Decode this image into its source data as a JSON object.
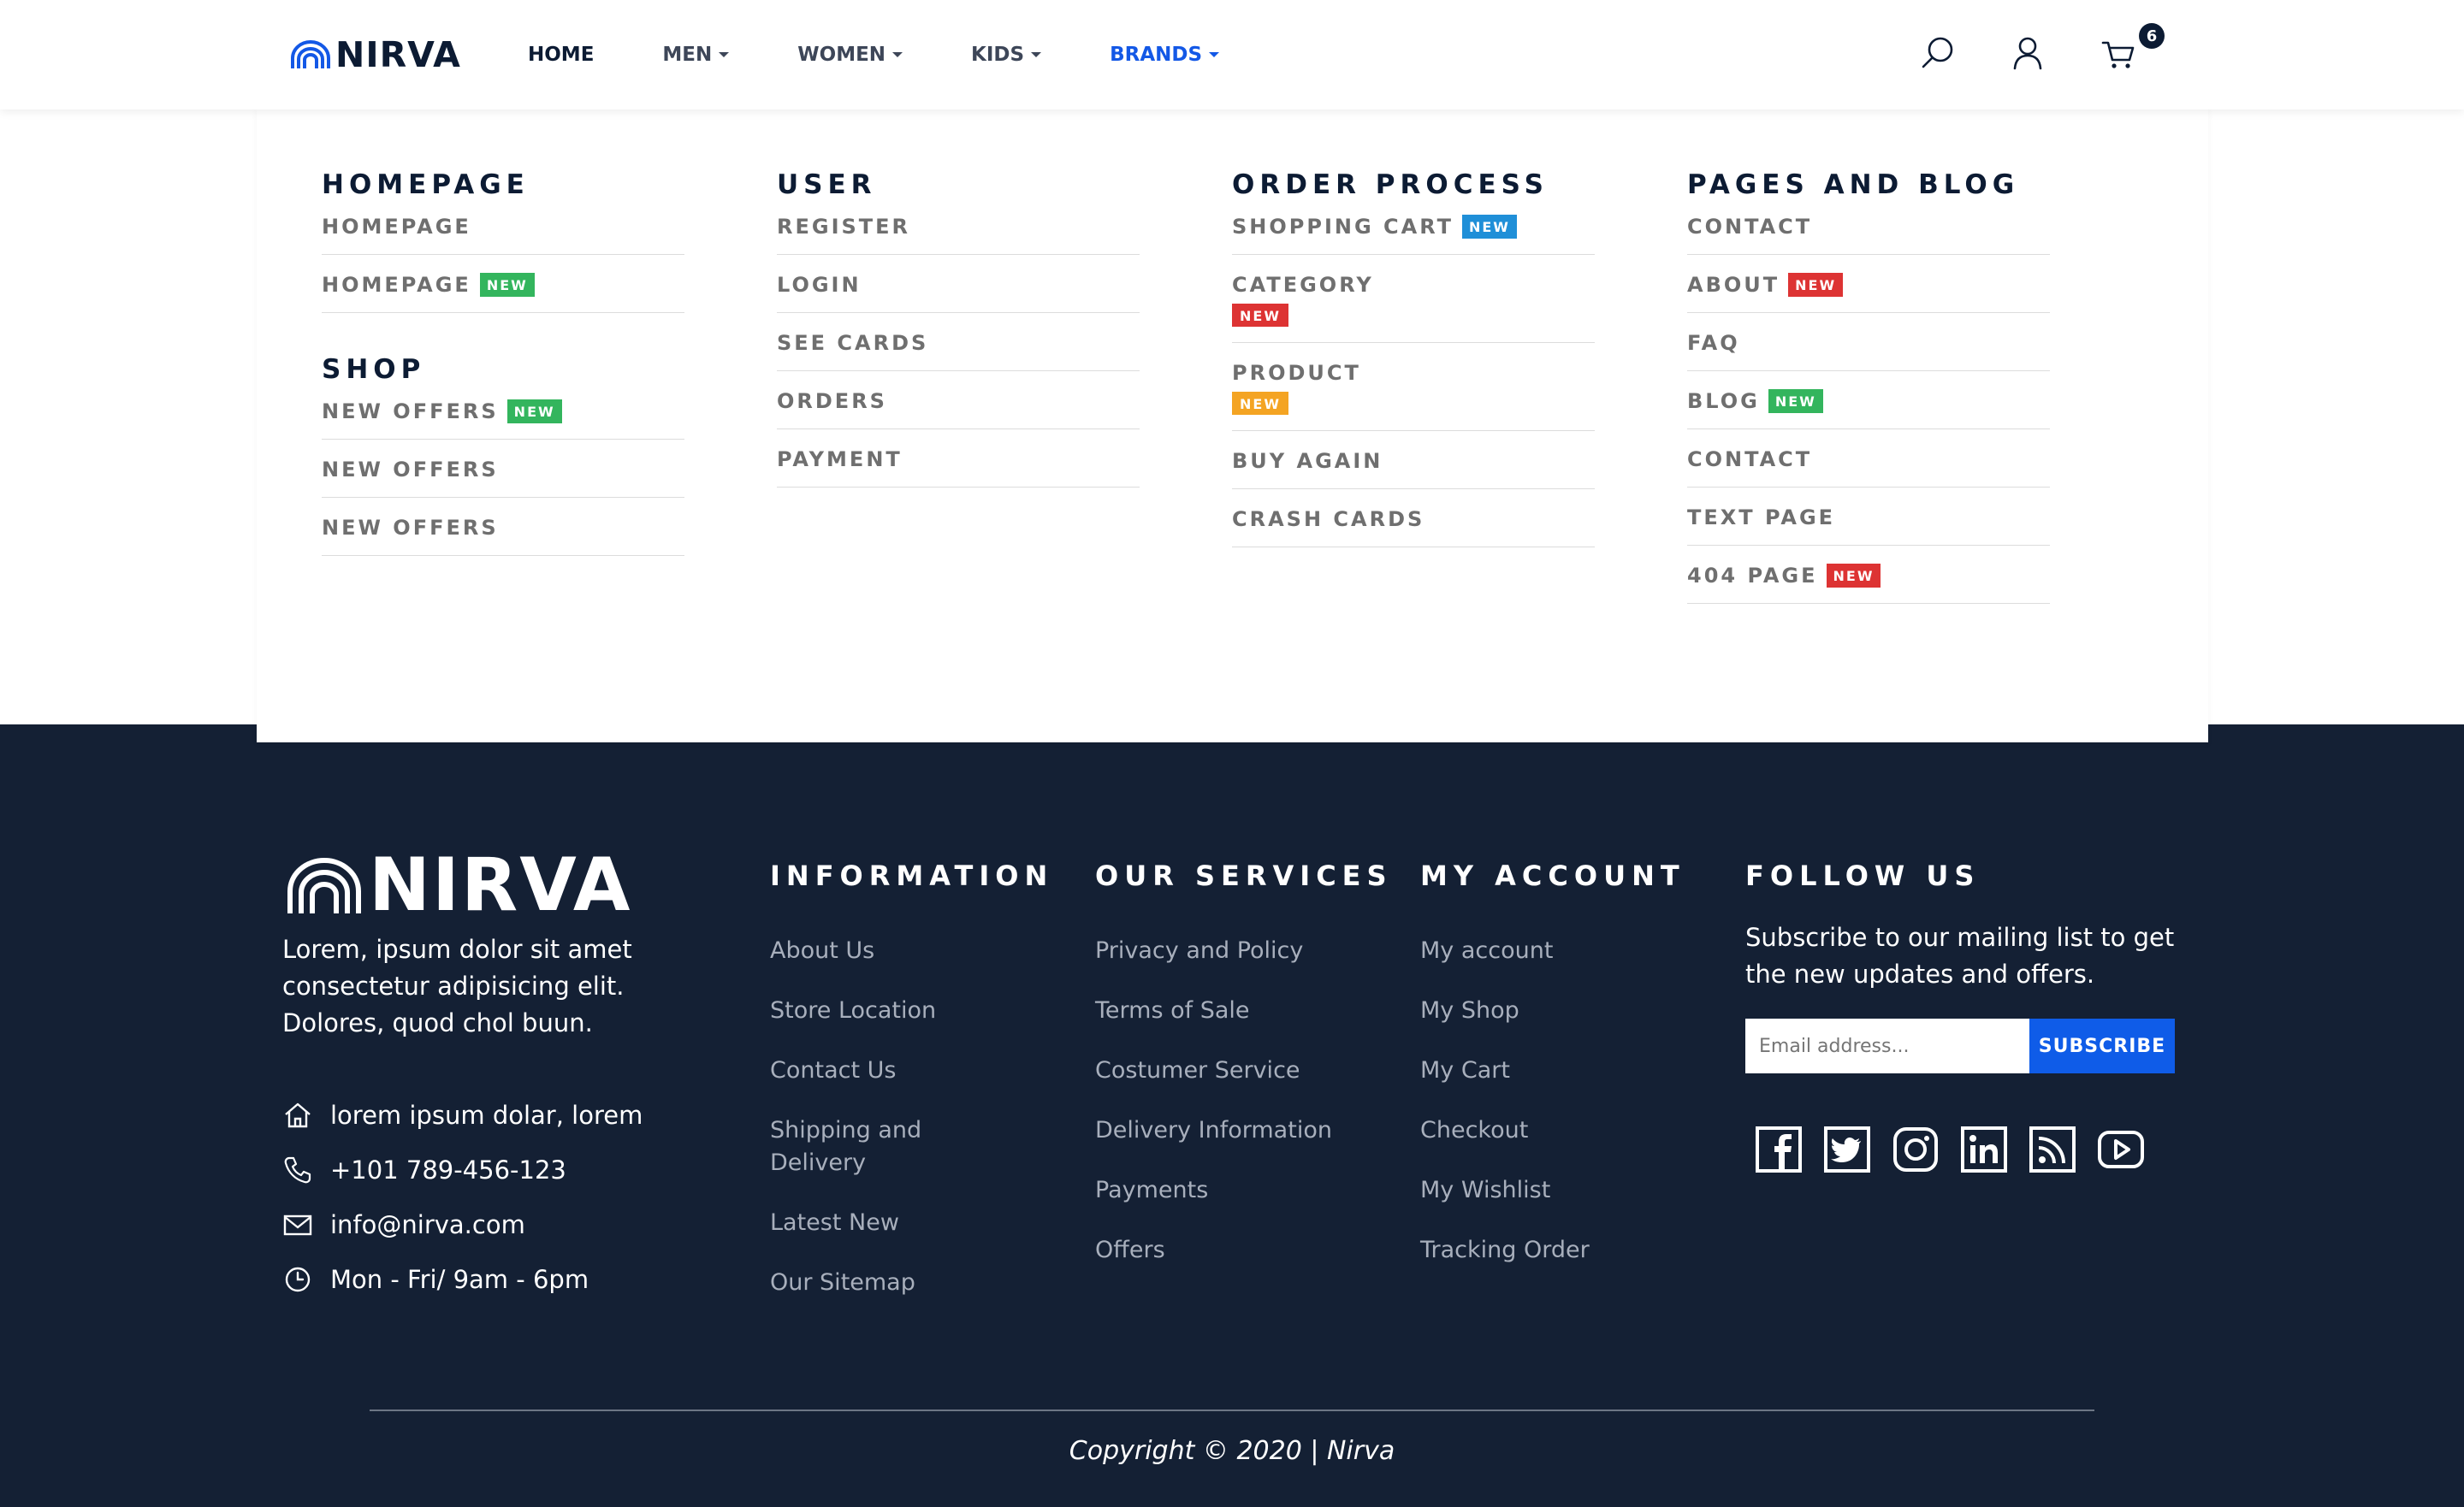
{
  "header": {
    "logo": "NIRVA",
    "nav": [
      {
        "label": "HOME"
      },
      {
        "label": "MEN"
      },
      {
        "label": "WOMEN"
      },
      {
        "label": "KIDS"
      },
      {
        "label": "BRANDS"
      }
    ],
    "cart_count": "6",
    "icons": [
      "search-icon",
      "user-icon",
      "cart-icon"
    ]
  },
  "mega": {
    "homepage": {
      "title": "HOMEPAGE",
      "links": [
        {
          "label": "HOMEPAGE",
          "badge": ""
        },
        {
          "label": "HOMEPAGE",
          "badge": "NEW"
        }
      ]
    },
    "shop": {
      "title": "SHOP",
      "links": [
        {
          "label": "NEW OFFERS",
          "badge": "NEW"
        },
        {
          "label": "NEW OFFERS",
          "badge": ""
        },
        {
          "label": "NEW OFFERS",
          "badge": ""
        }
      ]
    },
    "user": {
      "title": "USER",
      "links": [
        {
          "label": "REGISTER"
        },
        {
          "label": "LOGIN"
        },
        {
          "label": "SEE CARDS"
        },
        {
          "label": "ORDERS"
        },
        {
          "label": "PAYMENT"
        }
      ]
    },
    "order": {
      "title": "ORDER PROCESS",
      "links": [
        {
          "label": "SHOPPING CART",
          "badge": "NEW"
        },
        {
          "label": "CATEGORY",
          "badge": "NEW"
        },
        {
          "label": "PRODUCT",
          "badge": "NEW"
        },
        {
          "label": "BUY AGAIN",
          "badge": ""
        },
        {
          "label": "CRASH CARDS",
          "badge": ""
        }
      ]
    },
    "pages": {
      "title": "PAGES AND BLOG",
      "links": [
        {
          "label": "CONTACT",
          "badge": ""
        },
        {
          "label": "ABOUT",
          "badge": "NEW"
        },
        {
          "label": "FAQ",
          "badge": ""
        },
        {
          "label": "BLOG",
          "badge": "NEW"
        },
        {
          "label": "CONTACT",
          "badge": ""
        },
        {
          "label": "TEXT PAGE",
          "badge": ""
        },
        {
          "label": "404 PAGE",
          "badge": "NEW"
        }
      ]
    },
    "badge_colors": {
      "green": "#33b55d",
      "blue": "#1f8fd8",
      "red": "#dd3333",
      "orange": "#f4a423"
    }
  },
  "footer": {
    "logo": "NIRVA",
    "about": "Lorem, ipsum dolor sit amet consectetur adipisicing elit. Dolores, quod chol buun.",
    "contact": {
      "address": "lorem ipsum dolar, lorem",
      "phone": "+101 789-456-123",
      "email": "info@nirva.com",
      "hours": "Mon - Fri/ 9am - 6pm"
    },
    "information": {
      "title": "INFORMATION",
      "links": [
        "About Us",
        "Store Location",
        "Contact Us",
        "Shipping and Delivery",
        "Latest New",
        "Our Sitemap"
      ]
    },
    "services": {
      "title": "OUR SERVICES",
      "links": [
        "Privacy and Policy",
        "Terms of Sale",
        "Costumer Service",
        "Delivery Information",
        "Payments",
        "Offers"
      ]
    },
    "account": {
      "title": "MY ACCOUNT",
      "links": [
        "My account",
        "My Shop",
        "My Cart",
        "Checkout",
        "My Wishlist",
        "Tracking Order"
      ]
    },
    "follow": {
      "title": "FOLLOW US",
      "text": "Subscribe to our mailing list to get the new updates and offers.",
      "email_placeholder": "Email address...",
      "subscribe_label": "SUBSCRIBE",
      "socials": [
        "facebook-icon",
        "twitter-icon",
        "instagram-icon",
        "linkedin-icon",
        "rss-icon",
        "youtube-icon"
      ]
    },
    "copyright": "Copyright © 2020 | Nirva"
  },
  "colors": {
    "navy": "#0c1b33",
    "footer_bg": "#142034",
    "accent": "#1358e6",
    "subscribe": "#0f5ce8"
  }
}
